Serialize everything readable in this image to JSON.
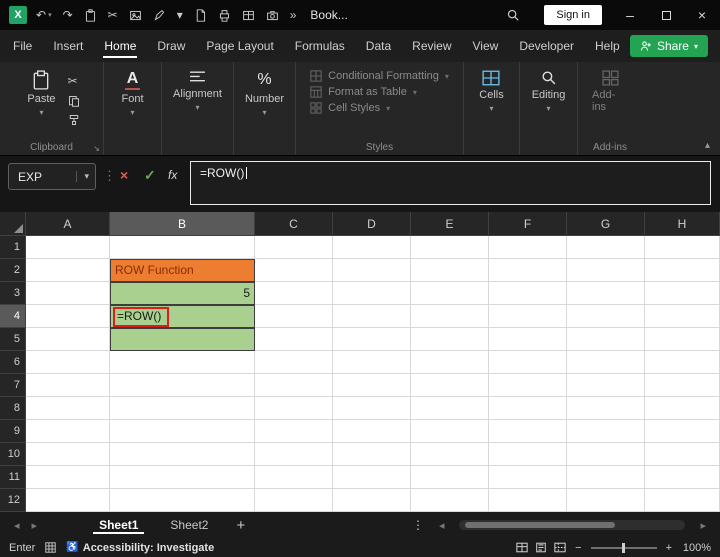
{
  "colors": {
    "excel_green": "#21a366",
    "share_green": "#22a452",
    "annotation_red": "#e01b1b",
    "cancel_red": "#d9604f",
    "confirm_green": "#6aa84f",
    "cell_orange": "#ED7D31",
    "cell_green": "#A9D08E"
  },
  "icons": {
    "excel_logo": "X",
    "undo": "↶",
    "redo": "↷",
    "cut": "✂",
    "chevron_down": "▾",
    "overflow": "»",
    "minimize": "–",
    "close": "×",
    "cancel": "×",
    "confirm": "✓",
    "fx": "fx",
    "dots": "⋮",
    "tab_prev": "◂",
    "tab_next": "▸",
    "launcher": "↘",
    "collapse": "▴",
    "accessibility": "♿",
    "zoom_minus": "−",
    "zoom_plus": "+"
  },
  "title_bar": {
    "workbook_name": "Book...",
    "sign_in_label": "Sign in"
  },
  "menu_bar": {
    "items": [
      "File",
      "Insert",
      "Home",
      "Draw",
      "Page Layout",
      "Formulas",
      "Data",
      "Review",
      "View",
      "Developer",
      "Help"
    ],
    "active_item": "Home",
    "share_label": "Share"
  },
  "ribbon": {
    "paste_label": "Paste",
    "font_label": "Font",
    "alignment_label": "Alignment",
    "number_label": "Number",
    "styles_items": [
      "Conditional Formatting",
      "Format as Table",
      "Cell Styles"
    ],
    "cells_label": "Cells",
    "editing_label": "Editing",
    "addins_button_label": "Add-ins",
    "group_labels": {
      "clipboard": "Clipboard",
      "styles": "Styles",
      "addins": "Add-ins"
    }
  },
  "formula_bar": {
    "name_box_value": "EXP",
    "formula_value": "=ROW()"
  },
  "grid": {
    "columns": [
      "A",
      "B",
      "C",
      "D",
      "E",
      "F",
      "G",
      "H"
    ],
    "rows": [
      "1",
      "2",
      "3",
      "4",
      "5",
      "6",
      "7",
      "8",
      "9",
      "10",
      "11",
      "12"
    ],
    "selected_column": "B",
    "selected_row": "4",
    "cells": [
      {
        "ref": "B2",
        "text": "ROW Function",
        "bg": "#ED7D31",
        "color": "#8a2d00",
        "align": "left",
        "bordered": true
      },
      {
        "ref": "B3",
        "text": "5",
        "bg": "#A9D08E",
        "color": "#1a1a1a",
        "align": "right",
        "bordered": true
      },
      {
        "ref": "B4",
        "text": "=ROW()",
        "bg": "#A9D08E",
        "color": "#1a1a1a",
        "align": "left",
        "bordered": true,
        "annotated": true
      },
      {
        "ref": "B5",
        "text": "",
        "bg": "#A9D08E",
        "color": "#1a1a1a",
        "align": "left",
        "bordered": true
      }
    ]
  },
  "sheet_bar": {
    "tabs": [
      "Sheet1",
      "Sheet2"
    ],
    "active_tab": "Sheet1",
    "add_label": "+"
  },
  "status_bar": {
    "mode": "Enter",
    "accessibility": "Accessibility: Investigate",
    "zoom": "100%"
  }
}
